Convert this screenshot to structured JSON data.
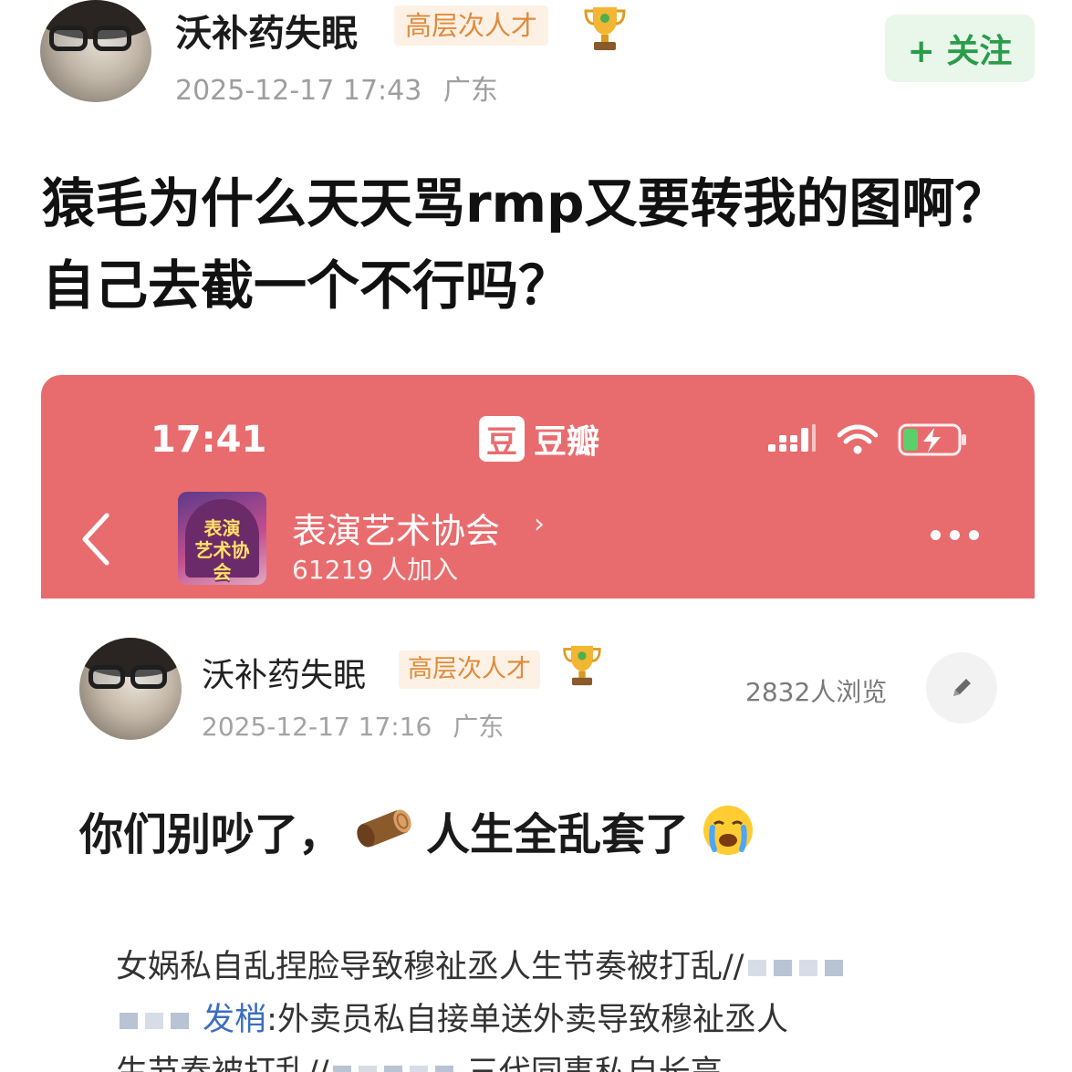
{
  "outer_post": {
    "author": "沃补药失眠",
    "badge": "高层次人才",
    "timestamp": "2025-12-17 17:43",
    "location": "广东",
    "follow_label": "+ 关注",
    "title": "猿毛为什么天天骂rmp又要转我的图啊？自己去截一个不行吗？"
  },
  "embedded_screenshot": {
    "status_bar": {
      "time": "17:41",
      "app_icon_char": "豆",
      "app_name": "豆瓣"
    },
    "group": {
      "thumb_text": "表演\n艺术协会",
      "name": "表演艺术协会",
      "members": "61219 人加入"
    },
    "post": {
      "author": "沃补药失眠",
      "badge": "高层次人才",
      "timestamp": "2025-12-17 17:16",
      "location": "广东",
      "views": "2832人浏览",
      "title_part1": "你们别吵了，",
      "title_part2": "人生全乱套了",
      "body_line1_text": "女娲私自乱捏脸导致穆祉丞人生节奏被打乱//",
      "body_line2_link": "发梢",
      "body_line2_text": ":外卖员私自接单送外卖导致穆祉丞人",
      "body_line3_text": "生节奏被打乱//",
      "body_line3_tail": "三代同事私自长高"
    }
  },
  "icons": [
    "trophy-icon",
    "plus-icon",
    "back-chevron-icon",
    "chevron-right-icon",
    "more-icon",
    "signal-icon",
    "wifi-icon",
    "battery-icon",
    "pencil-icon",
    "log-emoji",
    "crying-emoji"
  ],
  "colors": {
    "douban_header": "#e86c6e",
    "badge_bg": "#fcf1e4",
    "badge_text": "#e08a3c",
    "follow_bg": "#e9f6ea",
    "follow_text": "#2a9c4a",
    "link": "#3b6ec0"
  }
}
